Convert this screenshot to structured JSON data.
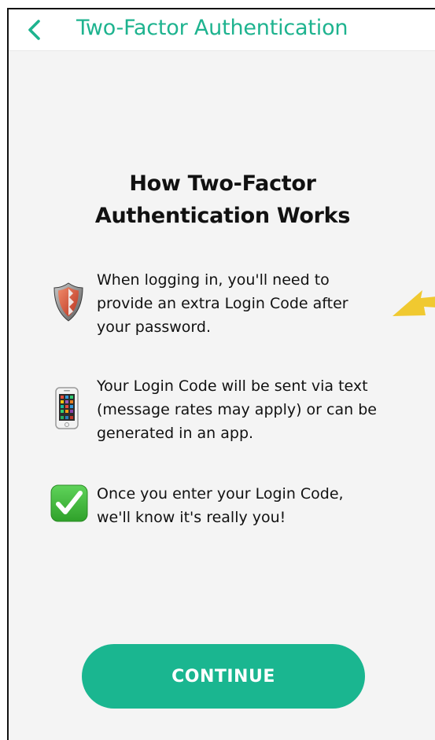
{
  "header": {
    "title": "Two-Factor Authentication",
    "back_icon": "chevron-left-icon"
  },
  "main": {
    "title_line1": "How Two-Factor",
    "title_line2": "Authentication Works",
    "items": [
      {
        "icon": "shield-icon",
        "lines": [
          "When logging in, you'll need to",
          "provide an extra Login Code after",
          "your password."
        ]
      },
      {
        "icon": "phone-icon",
        "lines": [
          "Your Login Code will be sent via text",
          "(message rates may apply) or can be",
          "generated in an app."
        ]
      },
      {
        "icon": "checkmark-icon",
        "lines": [
          "Once you enter your Login Code,",
          "we'll know it's really you!"
        ]
      }
    ]
  },
  "footer": {
    "continue_label": "CONTINUE"
  },
  "colors": {
    "accent": "#1eb38f",
    "button": "#1ab690",
    "background": "#f4f4f4",
    "arrow": "#f0c930"
  }
}
